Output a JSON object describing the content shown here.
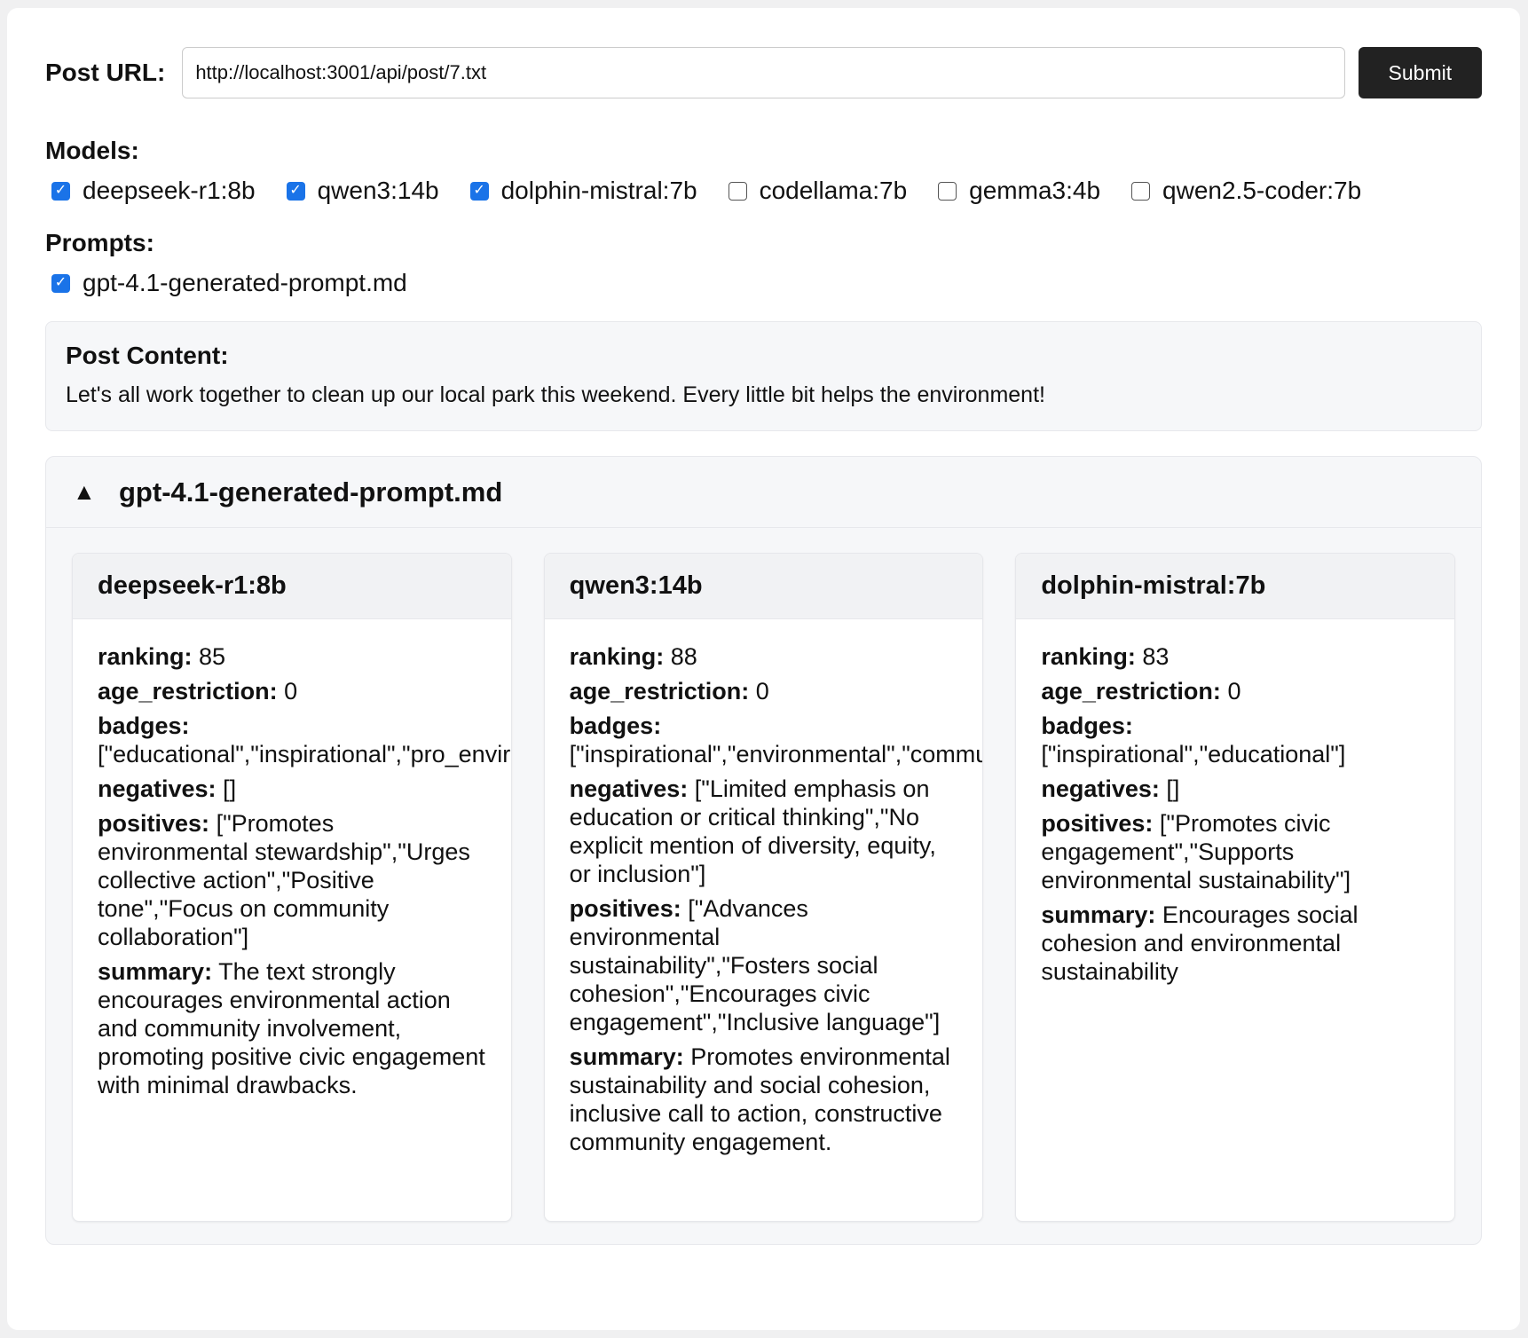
{
  "form": {
    "url_label": "Post URL:",
    "url_value": "http://localhost:3001/api/post/7.txt",
    "submit_label": "Submit"
  },
  "models": {
    "label": "Models:",
    "items": [
      {
        "label": "deepseek-r1:8b",
        "checked": true
      },
      {
        "label": "qwen3:14b",
        "checked": true
      },
      {
        "label": "dolphin-mistral:7b",
        "checked": true
      },
      {
        "label": "codellama:7b",
        "checked": false
      },
      {
        "label": "gemma3:4b",
        "checked": false
      },
      {
        "label": "qwen2.5-coder:7b",
        "checked": false
      }
    ]
  },
  "prompts": {
    "label": "Prompts:",
    "items": [
      {
        "label": "gpt-4.1-generated-prompt.md",
        "checked": true
      }
    ]
  },
  "post": {
    "title": "Post Content:",
    "text": "Let's all work together to clean up our local park this weekend. Every little bit helps the environment!"
  },
  "results": {
    "arrow": "▲",
    "prompt_title": "gpt-4.1-generated-prompt.md",
    "field_labels": {
      "ranking": "ranking:",
      "age_restriction": "age_restriction:",
      "badges": "badges:",
      "negatives": "negatives:",
      "positives": "positives:",
      "summary": "summary:"
    },
    "cards": [
      {
        "model": "deepseek-r1:8b",
        "ranking": "85",
        "age_restriction": "0",
        "badges": "[\"educational\",\"inspirational\",\"pro_environment\"]",
        "negatives": "[]",
        "positives": "[\"Promotes environmental stewardship\",\"Urges collective action\",\"Positive tone\",\"Focus on community collaboration\"]",
        "summary": "The text strongly encourages environmental action and community involvement, promoting positive civic engagement with minimal drawbacks."
      },
      {
        "model": "qwen3:14b",
        "ranking": "88",
        "age_restriction": "0",
        "badges": "[\"inspirational\",\"environmental\",\"community\"]",
        "negatives": "[\"Limited emphasis on education or critical thinking\",\"No explicit mention of diversity, equity, or inclusion\"]",
        "positives": "[\"Advances environmental sustainability\",\"Fosters social cohesion\",\"Encourages civic engagement\",\"Inclusive language\"]",
        "summary": "Promotes environmental sustainability and social cohesion, inclusive call to action, constructive community engagement."
      },
      {
        "model": "dolphin-mistral:7b",
        "ranking": "83",
        "age_restriction": "0",
        "badges": "[\"inspirational\",\"educational\"]",
        "negatives": "[]",
        "positives": "[\"Promotes civic engagement\",\"Supports environmental sustainability\"]",
        "summary": "Encourages social cohesion and environmental sustainability"
      }
    ]
  }
}
